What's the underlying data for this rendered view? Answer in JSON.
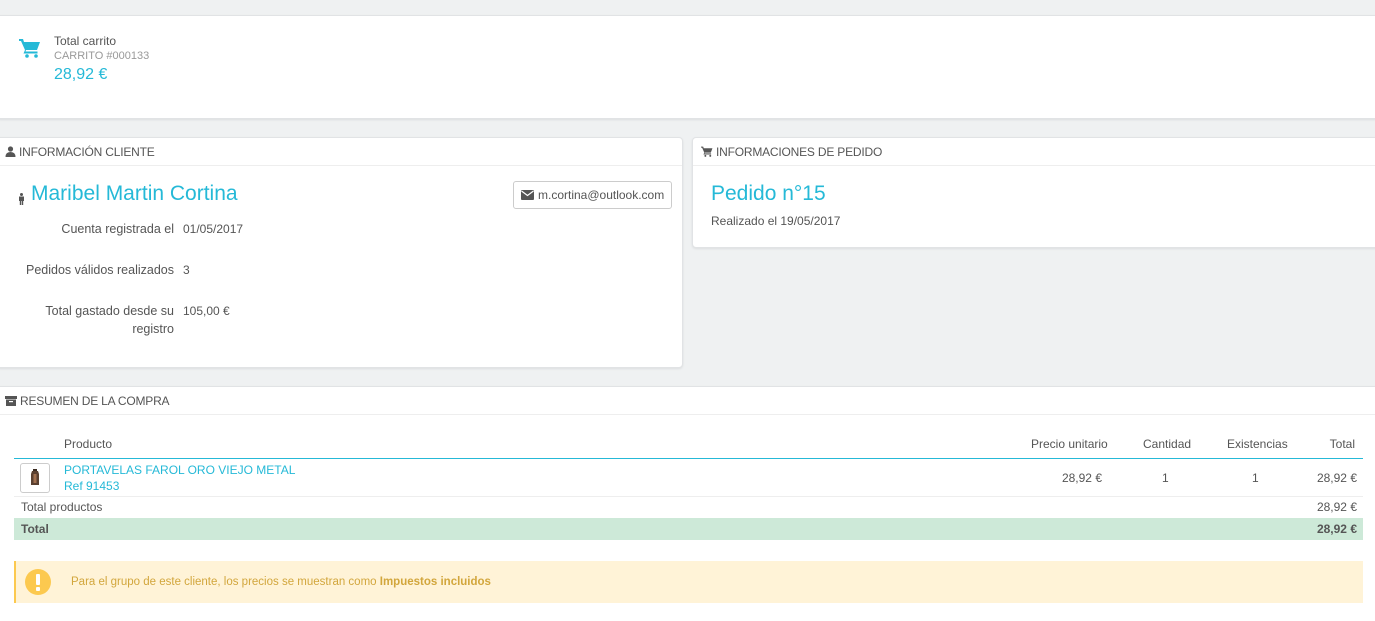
{
  "cart": {
    "title": "Total carrito",
    "id": "CARRITO #000133",
    "amount": "28,92 €"
  },
  "customer": {
    "heading": "INFORMACIÓN CLIENTE",
    "name": "Maribel Martin Cortina",
    "email": "m.cortina@outlook.com",
    "rows": [
      {
        "label": "Cuenta registrada el",
        "value": "01/05/2017"
      },
      {
        "label": "Pedidos válidos realizados",
        "value": "3"
      },
      {
        "label": "Total gastado desde su registro",
        "value": "105,00 €"
      }
    ]
  },
  "order": {
    "heading": "INFORMACIONES DE PEDIDO",
    "title": "Pedido n°15",
    "date": "Realizado el 19/05/2017"
  },
  "summary": {
    "heading": "RESUMEN DE LA COMPRA",
    "columns": {
      "product": "Producto",
      "unit_price": "Precio unitario",
      "quantity": "Cantidad",
      "stock": "Existencias",
      "total": "Total"
    },
    "product": {
      "name": "PORTAVELAS FAROL ORO VIEJO METAL",
      "ref": "Ref 91453",
      "unit_price": "28,92 €",
      "quantity": "1",
      "stock": "1",
      "total": "28,92 €"
    },
    "total_products_label": "Total productos",
    "total_products_value": "28,92 €",
    "total_label": "Total",
    "total_value": "28,92 €",
    "alert_text": "Para el grupo de este cliente, los precios se muestran como",
    "alert_bold": "Impuestos incluidos"
  },
  "colors": {
    "accent": "#25b9d7",
    "total_row": "#cde9d8",
    "alert_bg": "#fff3d7",
    "alert_icon": "#fcc94f"
  }
}
